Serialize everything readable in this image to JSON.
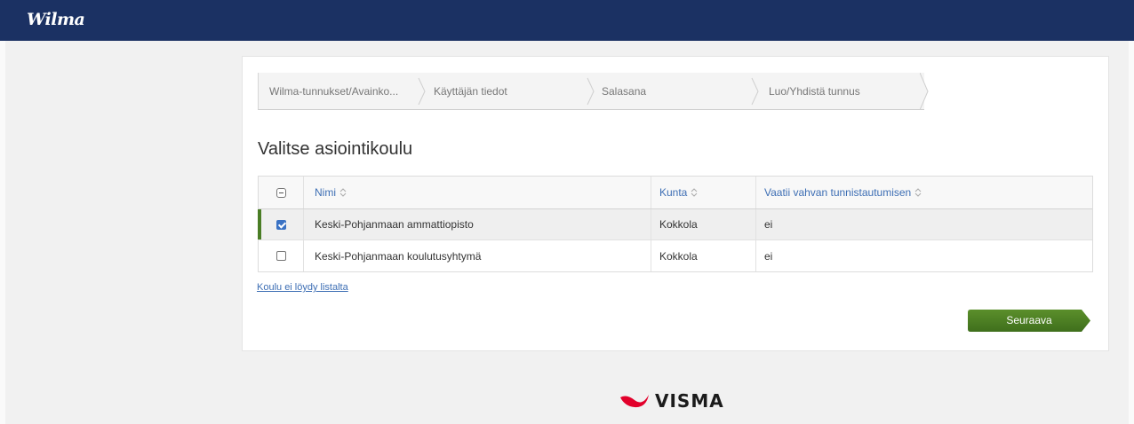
{
  "app": {
    "logo_text": "Wilma"
  },
  "wizard": {
    "steps": [
      {
        "label": "Wilma-tunnukset/Avainko..."
      },
      {
        "label": "Käyttäjän tiedot"
      },
      {
        "label": "Salasana"
      },
      {
        "label": "Luo/Yhdistä tunnus"
      }
    ]
  },
  "main": {
    "heading": "Valitse asiointikoulu",
    "table": {
      "columns": [
        {
          "label": "Nimi"
        },
        {
          "label": "Kunta"
        },
        {
          "label": "Vaatii vahvan tunnistautumisen"
        }
      ],
      "rows": [
        {
          "checked": true,
          "name": "Keski-Pohjanmaan ammattiopisto",
          "kunta": "Kokkola",
          "vaatii": "ei"
        },
        {
          "checked": false,
          "name": "Keski-Pohjanmaan koulutusyhtymä",
          "kunta": "Kokkola",
          "vaatii": "ei"
        }
      ]
    },
    "missing_link": "Koulu ei löydy listalta",
    "next_button": "Seuraava"
  },
  "footer": {
    "brand_text": "VISMA"
  },
  "colors": {
    "topbar": "#1b3163",
    "accent_green": "#4a7d25",
    "link_blue": "#3d6eb4",
    "brand_red": "#e2002b"
  }
}
